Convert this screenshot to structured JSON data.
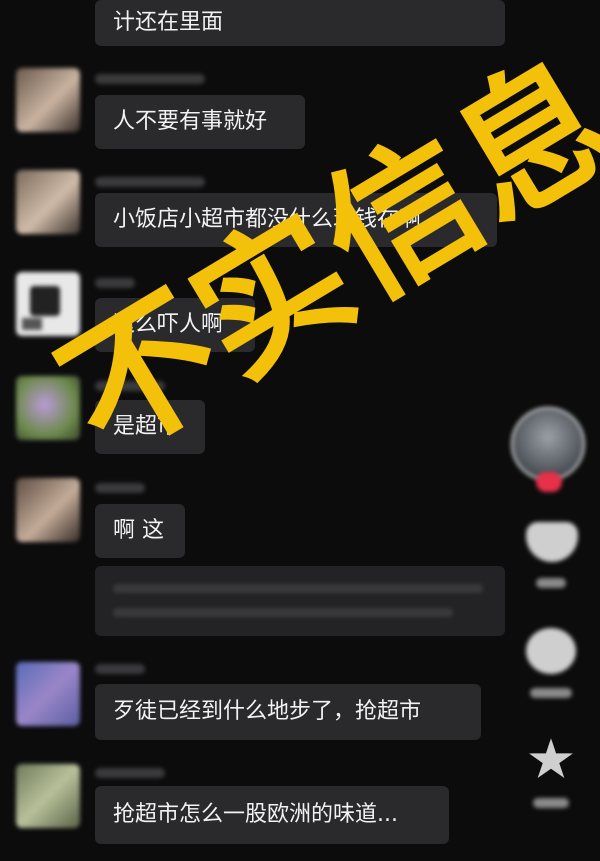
{
  "messages": [
    {
      "text": "计还在里面"
    },
    {
      "text": "人不要有事就好"
    },
    {
      "text": "小饭店小超市都没什么现钱在啊"
    },
    {
      "text": "这么吓人啊"
    },
    {
      "text": "是超市"
    },
    {
      "text": "啊 这"
    },
    {
      "text": "歹徒已经到什么地步了，抢超市"
    },
    {
      "text": "抢超市怎么一股欧洲的味道..."
    }
  ],
  "stamp": {
    "text": "不实信息",
    "color": "#f4c10a"
  },
  "colors": {
    "background": "#0c0c0d",
    "bubble": "#2a2a2c",
    "text": "#f2f2f2",
    "live_badge": "#e8304a"
  }
}
